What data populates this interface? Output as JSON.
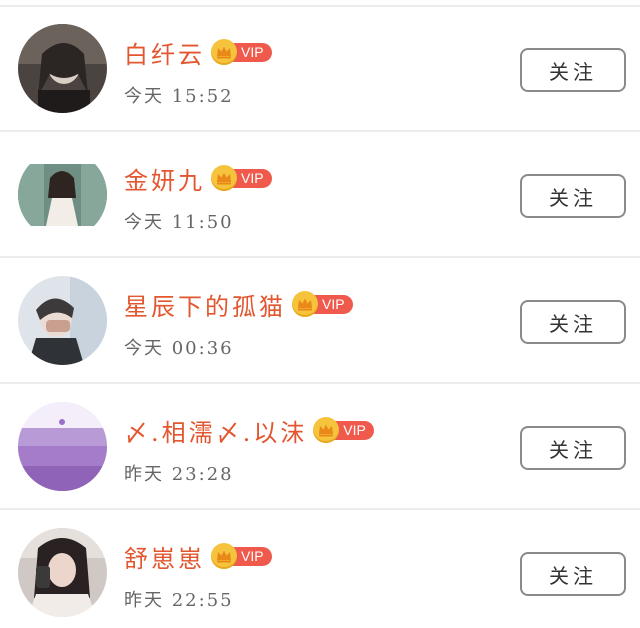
{
  "follow_list": {
    "vip_label": "VIP",
    "items": [
      {
        "name": "白纤云",
        "time": "今天 15:52",
        "button": "关注",
        "vip": true
      },
      {
        "name": "金妍九",
        "time": "今天 11:50",
        "button": "关注",
        "vip": true
      },
      {
        "name": "星辰下的孤猫",
        "time": "今天 00:36",
        "button": "关注",
        "vip": true
      },
      {
        "name": "〆.相濡〆.以沫",
        "time": "昨天 23:28",
        "button": "关注",
        "vip": true
      },
      {
        "name": "舒崽崽",
        "time": "昨天 22:55",
        "button": "关注",
        "vip": true
      }
    ]
  },
  "colors": {
    "name": "#e2572f",
    "vip_tag": "#ef5a4c",
    "crown": "#f6c33c",
    "time": "#666666",
    "button_border": "#8a8a8a"
  },
  "icons": {
    "vip": "crown-icon"
  }
}
